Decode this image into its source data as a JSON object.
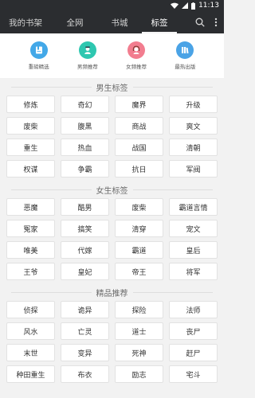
{
  "status_bar": {
    "time": "11:13"
  },
  "nav": {
    "tabs": [
      {
        "label": "我的书架"
      },
      {
        "label": "全网"
      },
      {
        "label": "书城"
      },
      {
        "label": "标签"
      }
    ]
  },
  "shortcuts": [
    {
      "label": "重磅精选",
      "color": "#43a8e8",
      "icon": "bookmark-book-icon"
    },
    {
      "label": "男频推荐",
      "color": "#2ec7b0",
      "icon": "male-reader-icon"
    },
    {
      "label": "女频推荐",
      "color": "#f27d8f",
      "icon": "female-reader-icon"
    },
    {
      "label": "最热出版",
      "color": "#4aa3e6",
      "icon": "books-icon"
    }
  ],
  "sections": [
    {
      "title": "男生标签",
      "tags": [
        "修炼",
        "奇幻",
        "魔界",
        "升级",
        "废柴",
        "腹黑",
        "商战",
        "爽文",
        "重生",
        "热血",
        "战国",
        "清朝",
        "权谋",
        "争霸",
        "抗日",
        "军阀"
      ]
    },
    {
      "title": "女生标签",
      "tags": [
        "恶魔",
        "酷男",
        "废柴",
        "霸道言情",
        "冤家",
        "搞笑",
        "清穿",
        "宠文",
        "唯美",
        "代嫁",
        "霸道",
        "皇后",
        "王爷",
        "皇妃",
        "帝王",
        "将军"
      ]
    },
    {
      "title": "精品推荐",
      "tags": [
        "侦探",
        "诡异",
        "探险",
        "法师",
        "风水",
        "亡灵",
        "道士",
        "丧尸",
        "末世",
        "变异",
        "死神",
        "赶尸",
        "种田重生",
        "布衣",
        "励志",
        "宅斗"
      ]
    }
  ]
}
